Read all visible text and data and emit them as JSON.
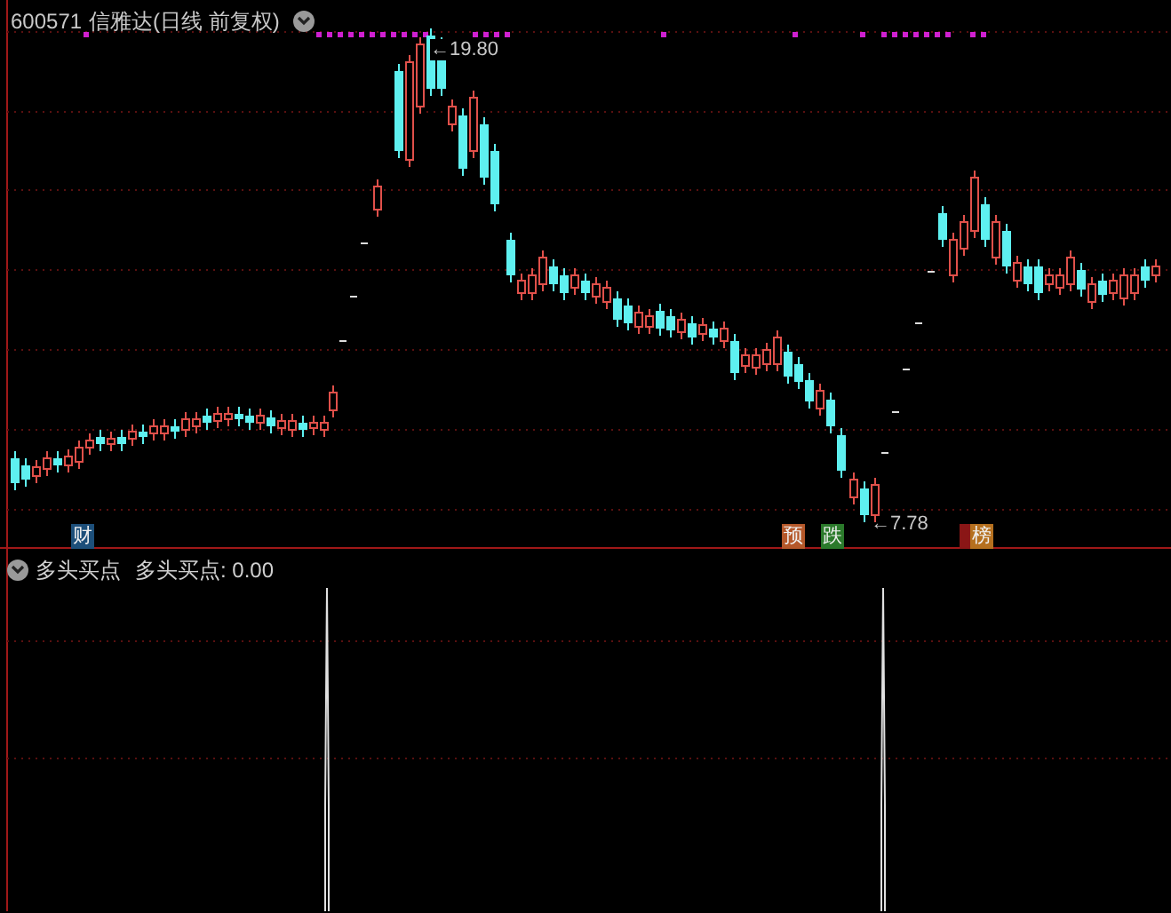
{
  "main_chart": {
    "code": "600571",
    "title": "信雅达(日线 前复权)",
    "high_label": "←19.80",
    "low_label": "←7.78"
  },
  "badges": [
    {
      "text": "财",
      "color": "#1d4f7a"
    },
    {
      "text": "预",
      "color": "#b5582a"
    },
    {
      "text": "跌",
      "color": "#2b7a2b"
    },
    {
      "color": "#8a1616"
    },
    {
      "text": "榜",
      "color": "#b5701f"
    }
  ],
  "indicator": {
    "name": "多头买点",
    "reading": "多头买点: 0.00"
  }
}
